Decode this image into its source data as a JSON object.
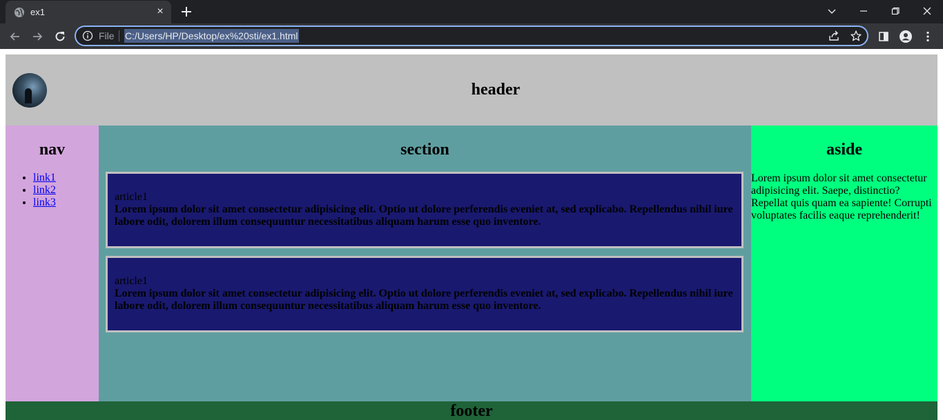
{
  "browser": {
    "tab_title": "ex1",
    "tab_close": "×",
    "scheme_label": "File",
    "url": "C:/Users/HP/Desktop/ex%20sti/ex1.html",
    "colors": {
      "frame": "#202124",
      "toolbar": "#35363a",
      "omnibox_border": "#8ab4f8"
    }
  },
  "page": {
    "header": {
      "title": "header",
      "color": "#c0c0c0"
    },
    "nav": {
      "title": "nav",
      "color": "#d3a5dd",
      "links": [
        {
          "label": "link1"
        },
        {
          "label": "link2"
        },
        {
          "label": "link3"
        }
      ]
    },
    "section": {
      "title": "section",
      "color": "#5f9ea0",
      "articles": [
        {
          "title": "article1",
          "body": "Lorem ipsum dolor sit amet consectetur adipisicing elit. Optio ut dolore perferendis eveniet at, sed explicabo. Repellendus nihil iure labore odit, dolorem illum consequuntur necessitatibus aliquam harum esse quo inventore."
        },
        {
          "title": "article1",
          "body": "Lorem ipsum dolor sit amet consectetur adipisicing elit. Optio ut dolore perferendis eveniet at, sed explicabo. Repellendus nihil iure labore odit, dolorem illum consequuntur necessitatibus aliquam harum esse quo inventore."
        }
      ],
      "article_color": "#191970"
    },
    "aside": {
      "title": "aside",
      "color": "#00ff7f",
      "text": "Lorem ipsum dolor sit amet consectetur adipisicing elit. Saepe, distinctio? Repellat quis quam ea sapiente! Corrupti voluptates facilis eaque reprehenderit!"
    },
    "footer": {
      "title": "footer",
      "color": "#1f6339"
    }
  }
}
